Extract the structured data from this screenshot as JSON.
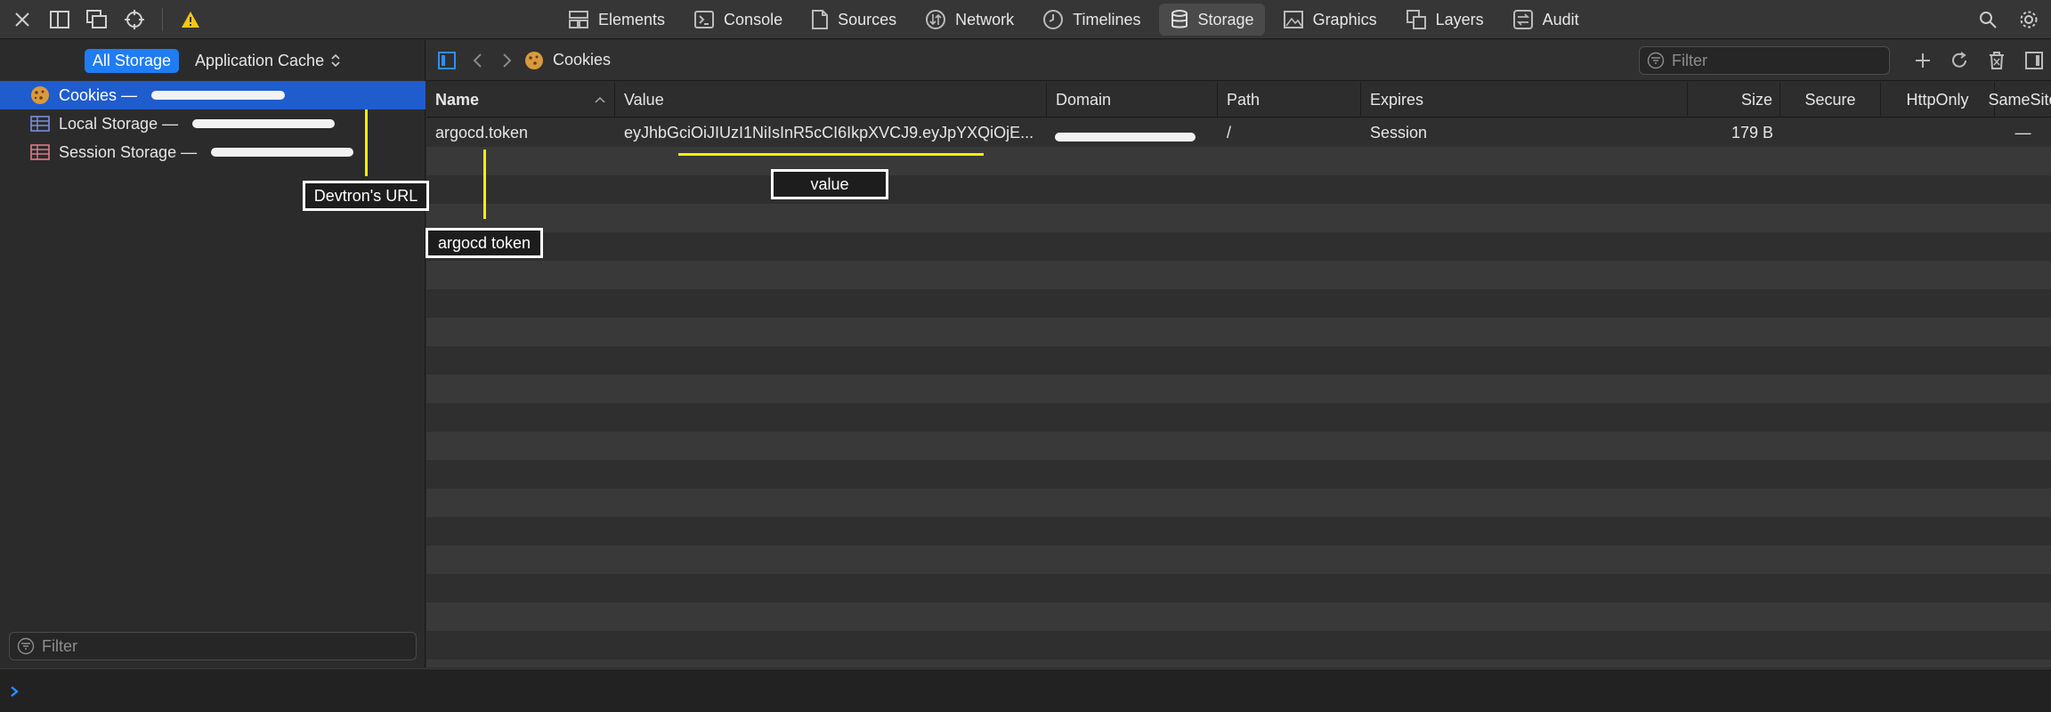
{
  "toolbar": {
    "tabs": [
      {
        "label": "Elements",
        "icon": "elements-icon",
        "active": false
      },
      {
        "label": "Console",
        "icon": "console-icon",
        "active": false
      },
      {
        "label": "Sources",
        "icon": "sources-icon",
        "active": false
      },
      {
        "label": "Network",
        "icon": "network-icon",
        "active": false
      },
      {
        "label": "Timelines",
        "icon": "timelines-icon",
        "active": false
      },
      {
        "label": "Storage",
        "icon": "storage-icon",
        "active": true
      },
      {
        "label": "Graphics",
        "icon": "graphics-icon",
        "active": false
      },
      {
        "label": "Layers",
        "icon": "layers-icon",
        "active": false
      },
      {
        "label": "Audit",
        "icon": "audit-icon",
        "active": false
      }
    ]
  },
  "sidebar": {
    "scope_all": "All Storage",
    "scope_cache": "Application Cache",
    "items": [
      {
        "label": "Cookies —",
        "icon": "cookie-icon"
      },
      {
        "label": "Local Storage —",
        "icon": "local-storage-icon"
      },
      {
        "label": "Session Storage —",
        "icon": "session-storage-icon"
      }
    ],
    "filter_placeholder": "Filter"
  },
  "main": {
    "breadcrumb": "Cookies",
    "filter_placeholder": "Filter",
    "columns": [
      "Name",
      "Value",
      "Domain",
      "Path",
      "Expires",
      "Size",
      "Secure",
      "HttpOnly",
      "SameSite"
    ],
    "rows": [
      {
        "name": "argocd.token",
        "value": "eyJhbGciOiJIUzI1NiIsInR5cCI6IkpXVCJ9.eyJpYXQiOjE...",
        "domain": "",
        "path": "/",
        "expires": "Session",
        "size": "179 B",
        "secure": "",
        "httponly": "",
        "samesite": "—"
      }
    ]
  },
  "annotations": {
    "url": "Devtron's URL",
    "token": "argocd token",
    "value": "value"
  },
  "colors": {
    "accent": "#1f7cf3",
    "selection": "#1f5ccd",
    "annotation_line": "#ffee00",
    "warning": "#f5c518"
  }
}
